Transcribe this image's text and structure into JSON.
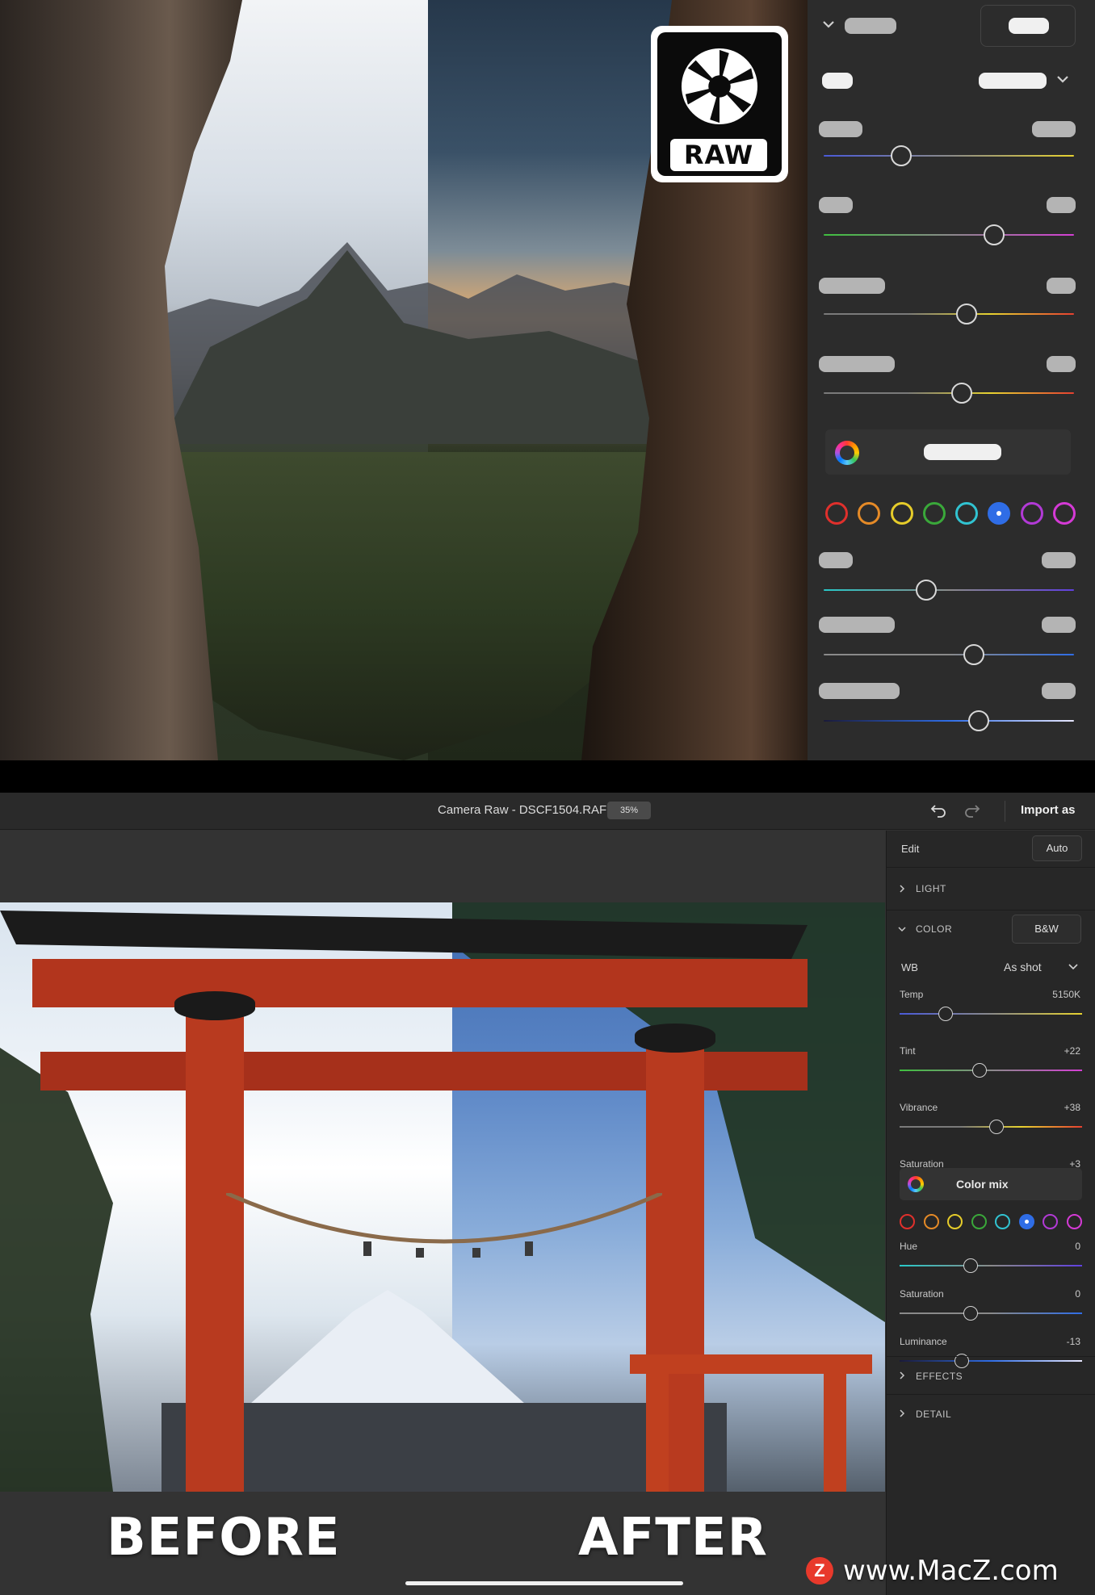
{
  "top_preview": {
    "badge_text": "RAW",
    "color_rings": [
      "#e0302c",
      "#e58a27",
      "#e6cc2a",
      "#3aa83a",
      "#31c3d1",
      "#2f6de6",
      "#b23ad6",
      "#d53ad6"
    ],
    "selected_ring": 5,
    "sliders": [
      {
        "position": 0.31,
        "gradient": [
          "#4a5ad8",
          "#8a8a8a",
          "#e6d230"
        ]
      },
      {
        "position": 0.68,
        "gradient": [
          "#3fbf3f",
          "#8a8a8a",
          "#d43fd4"
        ]
      },
      {
        "position": 0.57,
        "gradient": [
          "#7a7a7a",
          "#7a7a7a",
          "#e6d230",
          "#e64030"
        ]
      },
      {
        "position": 0.55,
        "gradient": [
          "#7a7a7a",
          "#7a7a7a",
          "#e6d230",
          "#e64030"
        ]
      },
      {
        "position": 0.41,
        "gradient": [
          "#28c8c8",
          "#8a8a8a",
          "#6040e0"
        ]
      },
      {
        "position": 0.6,
        "gradient": [
          "#8a8a8a",
          "#8a8a8a",
          "#2f6de6"
        ]
      },
      {
        "position": 0.62,
        "gradient": [
          "#1a1a3a",
          "#2f6de6",
          "#e8e8ff"
        ]
      }
    ]
  },
  "titlebar": {
    "title": "Camera Raw - DSCF1504.RAF",
    "zoom": "35%",
    "import_label": "Import as"
  },
  "photo": {
    "before_label": "BEFORE",
    "after_label": "AFTER"
  },
  "panel": {
    "edit_label": "Edit",
    "auto_label": "Auto",
    "light_label": "LIGHT",
    "color_label": "COLOR",
    "bw_label": "B&W",
    "wb_label": "WB",
    "wb_value": "As shot",
    "color_mix_label": "Color mix",
    "effects_label": "EFFECTS",
    "detail_label": "DETAIL",
    "wb_sliders": [
      {
        "name": "Temp",
        "value": "5150K",
        "position": 0.25,
        "gradient": [
          "#4a5ad8",
          "#8a8a8a",
          "#e6d230"
        ]
      },
      {
        "name": "Tint",
        "value": "+22",
        "position": 0.44,
        "gradient": [
          "#3fbf3f",
          "#8a8a8a",
          "#d43fd4"
        ]
      },
      {
        "name": "Vibrance",
        "value": "+38",
        "position": 0.53,
        "gradient": [
          "#7a7a7a",
          "#7a7a7a",
          "#e6d230",
          "#e64030"
        ]
      },
      {
        "name": "Saturation",
        "value": "+3",
        "position": 0.41,
        "gradient": [
          "#7a7a7a",
          "#7a7a7a",
          "#e6d230",
          "#e64030"
        ]
      }
    ],
    "color_rings": [
      "#e0302c",
      "#e58a27",
      "#e6cc2a",
      "#3aa83a",
      "#31c3d1",
      "#2f6de6",
      "#b23ad6",
      "#d53ad6"
    ],
    "selected_ring": 5,
    "mix_sliders": [
      {
        "name": "Hue",
        "value": "0",
        "position": 0.39,
        "gradient": [
          "#28c8c8",
          "#8a8a8a",
          "#6040e0"
        ]
      },
      {
        "name": "Saturation",
        "value": "0",
        "position": 0.39,
        "gradient": [
          "#8a8a8a",
          "#8a8a8a",
          "#2f6de6"
        ]
      },
      {
        "name": "Luminance",
        "value": "-13",
        "position": 0.34,
        "gradient": [
          "#1a1a3a",
          "#2f6de6",
          "#e8e8ff"
        ]
      }
    ]
  },
  "watermark": {
    "logo_letter": "Z",
    "site": "www.MacZ.com"
  }
}
